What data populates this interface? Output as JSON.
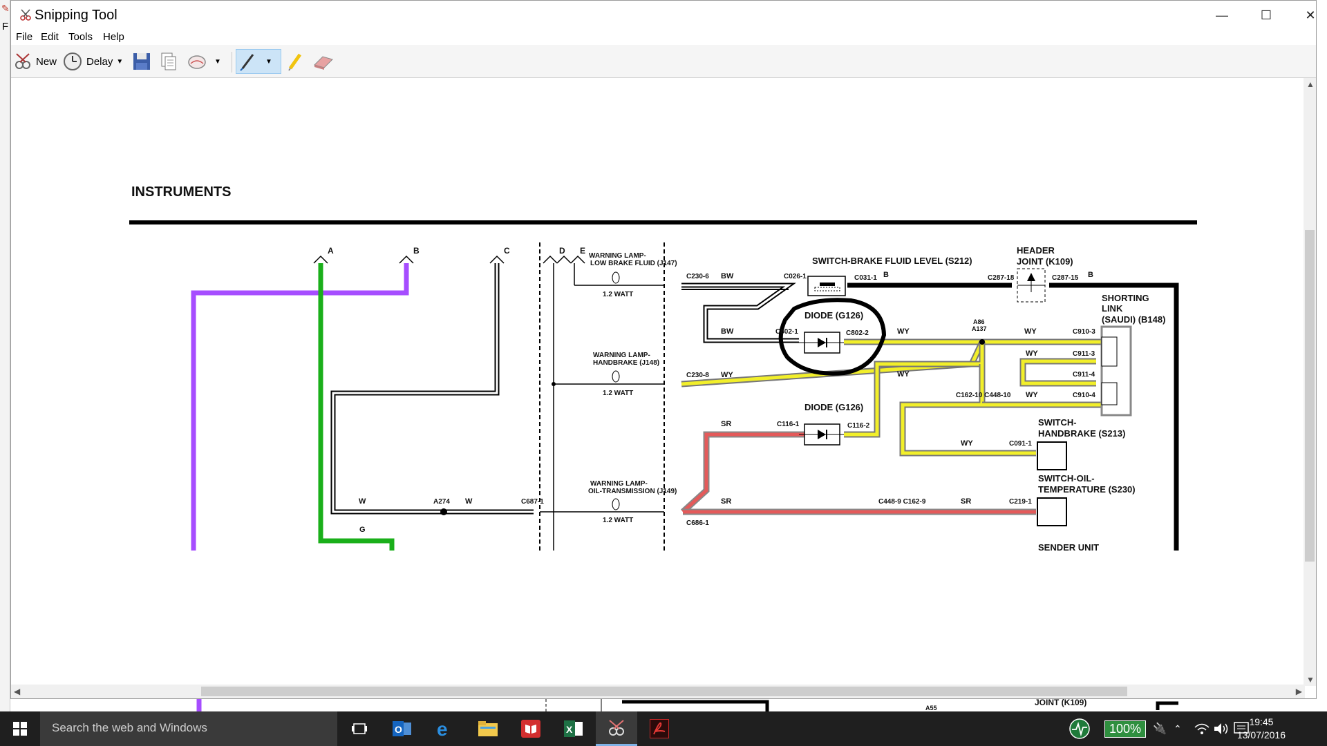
{
  "window": {
    "title": "Snipping Tool",
    "minimize_glyph": "—",
    "maximize_glyph": "☐",
    "close_glyph": "✕"
  },
  "background_app": {
    "menu_letter": "F"
  },
  "menu": {
    "items": [
      "File",
      "Edit",
      "Tools",
      "Help"
    ]
  },
  "toolbar": {
    "new_label": "New",
    "delay_label": "Delay"
  },
  "diagram": {
    "title": "INSTRUMENTS",
    "connectors": {
      "a": "A",
      "b": "B",
      "c": "C",
      "d": "D",
      "e": "E",
      "w1": "W",
      "w2": "W",
      "a274": "A274",
      "c687": "C687-1",
      "g": "G",
      "sr1": "SR",
      "sr2": "SR",
      "sr3": "SR",
      "c686": "C686-1",
      "c448_9_c162_9": "C448-9 C162-9",
      "c219": "C219-1",
      "c230_6": "C230-6",
      "bw1": "BW",
      "c026": "C026-1",
      "c031": "C031-1",
      "b1": "B",
      "c287_18": "C287-18",
      "c287_15": "C287-15",
      "b2": "B",
      "bw2": "BW",
      "c802_1": "C802-1",
      "c802_2": "C802-2",
      "wy1": "WY",
      "a86": "A86",
      "a137": "A137",
      "wy2": "WY",
      "c910_3": "C910-3",
      "wy3": "WY",
      "c911_3": "C911-3",
      "c911_4": "C911-4",
      "c230_8": "C230-8",
      "wy4": "WY",
      "wy5": "WY",
      "c162_10_c448_10": "C162-10 C448-10",
      "wy6": "WY",
      "c910_4": "C910-4",
      "c116_1": "C116-1",
      "c116_2": "C116-2",
      "wy7": "WY",
      "c091": "C091-1",
      "a55": "A55",
      "joint_k109_bottom": "JOINT (K109)"
    },
    "components": {
      "lamp_low_brake_1": "WARNING LAMP-",
      "lamp_low_brake_2": "LOW BRAKE FLUID (J147)",
      "lamp_low_brake_w": "1.2 WATT",
      "lamp_handbrake_1": "WARNING LAMP-",
      "lamp_handbrake_2": "HANDBRAKE (J148)",
      "lamp_handbrake_w": "1.2 WATT",
      "lamp_oil_1": "WARNING LAMP-",
      "lamp_oil_2": "OIL-TRANSMISSION (J149)",
      "lamp_oil_w": "1.2 WATT",
      "switch_brake_fluid": "SWITCH-BRAKE FLUID LEVEL (S212)",
      "header_joint_1": "HEADER",
      "header_joint_2": "JOINT (K109)",
      "diode_1": "DIODE (G126)",
      "diode_2": "DIODE (G126)",
      "shorting_link_1": "SHORTING",
      "shorting_link_2": "LINK",
      "shorting_link_3": "(SAUDI) (B148)",
      "switch_handbrake_1": "SWITCH-",
      "switch_handbrake_2": "HANDBRAKE (S213)",
      "switch_oil_1": "SWITCH-OIL-",
      "switch_oil_2": "TEMPERATURE (S230)",
      "sender_unit": "SENDER UNIT"
    }
  },
  "taskbar": {
    "search_placeholder": "Search the web and Windows",
    "battery_percent": "100%",
    "time": "19:45",
    "date": "13/07/2016"
  },
  "colors": {
    "wire_purple": "#a64dff",
    "wire_green": "#1aaf1a",
    "wire_yellow": "#f2ef2a",
    "wire_red": "#e45a5a",
    "wire_black": "#000000"
  }
}
